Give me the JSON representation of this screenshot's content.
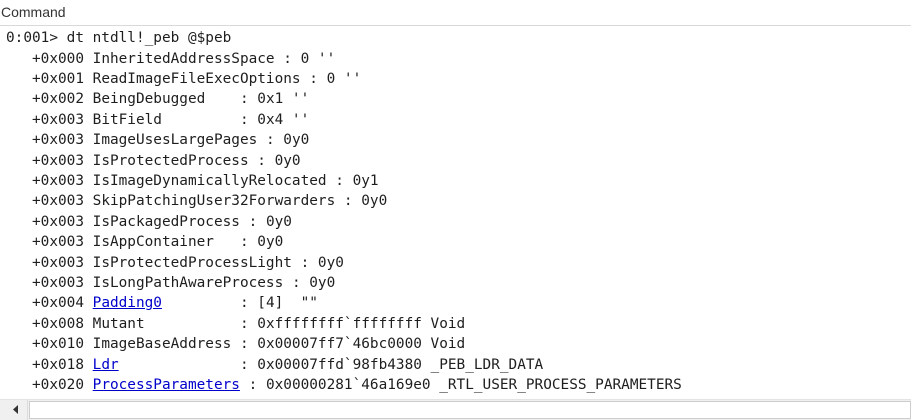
{
  "window": {
    "title": "Command"
  },
  "command": {
    "prompt": "0:001> ",
    "text": "dt ntdll!_peb @$peb"
  },
  "rows": [
    {
      "offset": "+0x000",
      "field": "InheritedAddressSpace",
      "pad": " ",
      "value": ": 0 ''"
    },
    {
      "offset": "+0x001",
      "field": "ReadImageFileExecOptions",
      "pad": " ",
      "value": ": 0 ''"
    },
    {
      "offset": "+0x002",
      "field": "BeingDebugged",
      "pad": "    ",
      "value": ": 0x1 ''"
    },
    {
      "offset": "+0x003",
      "field": "BitField",
      "pad": "         ",
      "value": ": 0x4 ''"
    },
    {
      "offset": "+0x003",
      "field": "ImageUsesLargePages",
      "pad": " ",
      "value": ": 0y0"
    },
    {
      "offset": "+0x003",
      "field": "IsProtectedProcess",
      "pad": " ",
      "value": ": 0y0"
    },
    {
      "offset": "+0x003",
      "field": "IsImageDynamicallyRelocated",
      "pad": " ",
      "value": ": 0y1"
    },
    {
      "offset": "+0x003",
      "field": "SkipPatchingUser32Forwarders",
      "pad": " ",
      "value": ": 0y0"
    },
    {
      "offset": "+0x003",
      "field": "IsPackagedProcess",
      "pad": " ",
      "value": ": 0y0"
    },
    {
      "offset": "+0x003",
      "field": "IsAppContainer",
      "pad": "   ",
      "value": ": 0y0"
    },
    {
      "offset": "+0x003",
      "field": "IsProtectedProcessLight",
      "pad": " ",
      "value": ": 0y0"
    },
    {
      "offset": "+0x003",
      "field": "IsLongPathAwareProcess",
      "pad": " ",
      "value": ": 0y0"
    },
    {
      "offset": "+0x004",
      "field": "Padding0",
      "link": true,
      "pad": "         ",
      "value": ": [4]  \"\""
    },
    {
      "offset": "+0x008",
      "field": "Mutant",
      "pad": "           ",
      "value": ": 0xffffffff`ffffffff Void"
    },
    {
      "offset": "+0x010",
      "field": "ImageBaseAddress",
      "pad": " ",
      "value": ": 0x00007ff7`46bc0000 Void"
    },
    {
      "offset": "+0x018",
      "field": "Ldr",
      "link": true,
      "pad": "              ",
      "value": ": 0x00007ffd`98fb4380 _PEB_LDR_DATA"
    },
    {
      "offset": "+0x020",
      "field": "ProcessParameters",
      "link": true,
      "pad": " ",
      "value": ": 0x00000281`46a169e0 _RTL_USER_PROCESS_PARAMETERS"
    }
  ],
  "scrollbar": {
    "left_arrow_icon": "chevron-left-icon"
  }
}
